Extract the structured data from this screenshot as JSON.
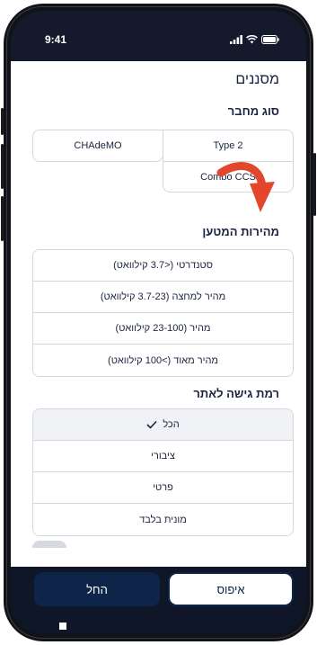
{
  "status_bar": {
    "time": "9:41"
  },
  "filters": {
    "title": "מסננים",
    "connector_section": {
      "title": "סוג מחבר",
      "options": [
        "Type 2",
        "CHAdeMO",
        "Combo CCS"
      ]
    },
    "speed_section": {
      "title": "מהירות המטען",
      "options": [
        "סטנדרטי (<3.7 קילוואט)",
        "מהיר למחצה (3.7-23 קילוואט)",
        "מהיר (23-100 קילוואט)",
        "מהיר מאוד (>100 קילוואט)"
      ]
    },
    "access_section": {
      "title": "רמת גישה לאתר",
      "options": [
        {
          "label": "הכל",
          "selected": true
        },
        {
          "label": "ציבורי",
          "selected": false
        },
        {
          "label": "פרטי",
          "selected": false
        },
        {
          "label": "מונית בלבד",
          "selected": false
        }
      ]
    }
  },
  "footer": {
    "reset_label": "איפוס",
    "start_label": "החל"
  },
  "colors": {
    "navy": "#0e2549",
    "arrow": "#e2462c",
    "dark": "#0f1628"
  },
  "annotation_icon": "red-curved-arrow-icon"
}
